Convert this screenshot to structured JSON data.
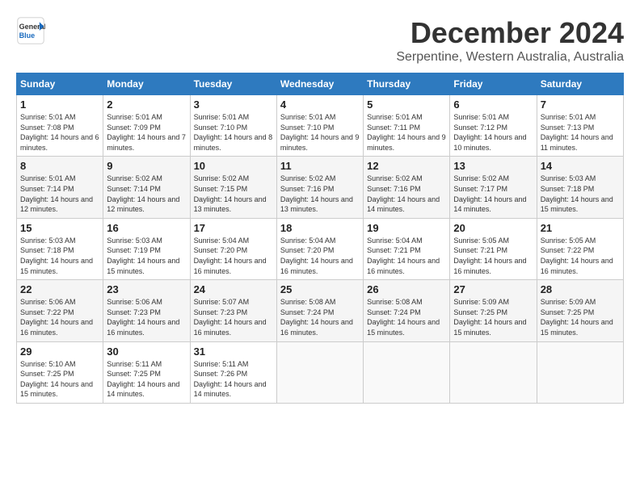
{
  "logo": {
    "line1": "General",
    "line2": "Blue"
  },
  "title": "December 2024",
  "location": "Serpentine, Western Australia, Australia",
  "weekdays": [
    "Sunday",
    "Monday",
    "Tuesday",
    "Wednesday",
    "Thursday",
    "Friday",
    "Saturday"
  ],
  "weeks": [
    [
      {
        "day": "1",
        "sunrise": "5:01 AM",
        "sunset": "7:08 PM",
        "daylight": "14 hours and 6 minutes."
      },
      {
        "day": "2",
        "sunrise": "5:01 AM",
        "sunset": "7:09 PM",
        "daylight": "14 hours and 7 minutes."
      },
      {
        "day": "3",
        "sunrise": "5:01 AM",
        "sunset": "7:10 PM",
        "daylight": "14 hours and 8 minutes."
      },
      {
        "day": "4",
        "sunrise": "5:01 AM",
        "sunset": "7:10 PM",
        "daylight": "14 hours and 9 minutes."
      },
      {
        "day": "5",
        "sunrise": "5:01 AM",
        "sunset": "7:11 PM",
        "daylight": "14 hours and 9 minutes."
      },
      {
        "day": "6",
        "sunrise": "5:01 AM",
        "sunset": "7:12 PM",
        "daylight": "14 hours and 10 minutes."
      },
      {
        "day": "7",
        "sunrise": "5:01 AM",
        "sunset": "7:13 PM",
        "daylight": "14 hours and 11 minutes."
      }
    ],
    [
      {
        "day": "8",
        "sunrise": "5:01 AM",
        "sunset": "7:14 PM",
        "daylight": "14 hours and 12 minutes."
      },
      {
        "day": "9",
        "sunrise": "5:02 AM",
        "sunset": "7:14 PM",
        "daylight": "14 hours and 12 minutes."
      },
      {
        "day": "10",
        "sunrise": "5:02 AM",
        "sunset": "7:15 PM",
        "daylight": "14 hours and 13 minutes."
      },
      {
        "day": "11",
        "sunrise": "5:02 AM",
        "sunset": "7:16 PM",
        "daylight": "14 hours and 13 minutes."
      },
      {
        "day": "12",
        "sunrise": "5:02 AM",
        "sunset": "7:16 PM",
        "daylight": "14 hours and 14 minutes."
      },
      {
        "day": "13",
        "sunrise": "5:02 AM",
        "sunset": "7:17 PM",
        "daylight": "14 hours and 14 minutes."
      },
      {
        "day": "14",
        "sunrise": "5:03 AM",
        "sunset": "7:18 PM",
        "daylight": "14 hours and 15 minutes."
      }
    ],
    [
      {
        "day": "15",
        "sunrise": "5:03 AM",
        "sunset": "7:18 PM",
        "daylight": "14 hours and 15 minutes."
      },
      {
        "day": "16",
        "sunrise": "5:03 AM",
        "sunset": "7:19 PM",
        "daylight": "14 hours and 15 minutes."
      },
      {
        "day": "17",
        "sunrise": "5:04 AM",
        "sunset": "7:20 PM",
        "daylight": "14 hours and 16 minutes."
      },
      {
        "day": "18",
        "sunrise": "5:04 AM",
        "sunset": "7:20 PM",
        "daylight": "14 hours and 16 minutes."
      },
      {
        "day": "19",
        "sunrise": "5:04 AM",
        "sunset": "7:21 PM",
        "daylight": "14 hours and 16 minutes."
      },
      {
        "day": "20",
        "sunrise": "5:05 AM",
        "sunset": "7:21 PM",
        "daylight": "14 hours and 16 minutes."
      },
      {
        "day": "21",
        "sunrise": "5:05 AM",
        "sunset": "7:22 PM",
        "daylight": "14 hours and 16 minutes."
      }
    ],
    [
      {
        "day": "22",
        "sunrise": "5:06 AM",
        "sunset": "7:22 PM",
        "daylight": "14 hours and 16 minutes."
      },
      {
        "day": "23",
        "sunrise": "5:06 AM",
        "sunset": "7:23 PM",
        "daylight": "14 hours and 16 minutes."
      },
      {
        "day": "24",
        "sunrise": "5:07 AM",
        "sunset": "7:23 PM",
        "daylight": "14 hours and 16 minutes."
      },
      {
        "day": "25",
        "sunrise": "5:08 AM",
        "sunset": "7:24 PM",
        "daylight": "14 hours and 16 minutes."
      },
      {
        "day": "26",
        "sunrise": "5:08 AM",
        "sunset": "7:24 PM",
        "daylight": "14 hours and 15 minutes."
      },
      {
        "day": "27",
        "sunrise": "5:09 AM",
        "sunset": "7:25 PM",
        "daylight": "14 hours and 15 minutes."
      },
      {
        "day": "28",
        "sunrise": "5:09 AM",
        "sunset": "7:25 PM",
        "daylight": "14 hours and 15 minutes."
      }
    ],
    [
      {
        "day": "29",
        "sunrise": "5:10 AM",
        "sunset": "7:25 PM",
        "daylight": "14 hours and 15 minutes."
      },
      {
        "day": "30",
        "sunrise": "5:11 AM",
        "sunset": "7:25 PM",
        "daylight": "14 hours and 14 minutes."
      },
      {
        "day": "31",
        "sunrise": "5:11 AM",
        "sunset": "7:26 PM",
        "daylight": "14 hours and 14 minutes."
      },
      null,
      null,
      null,
      null
    ]
  ]
}
